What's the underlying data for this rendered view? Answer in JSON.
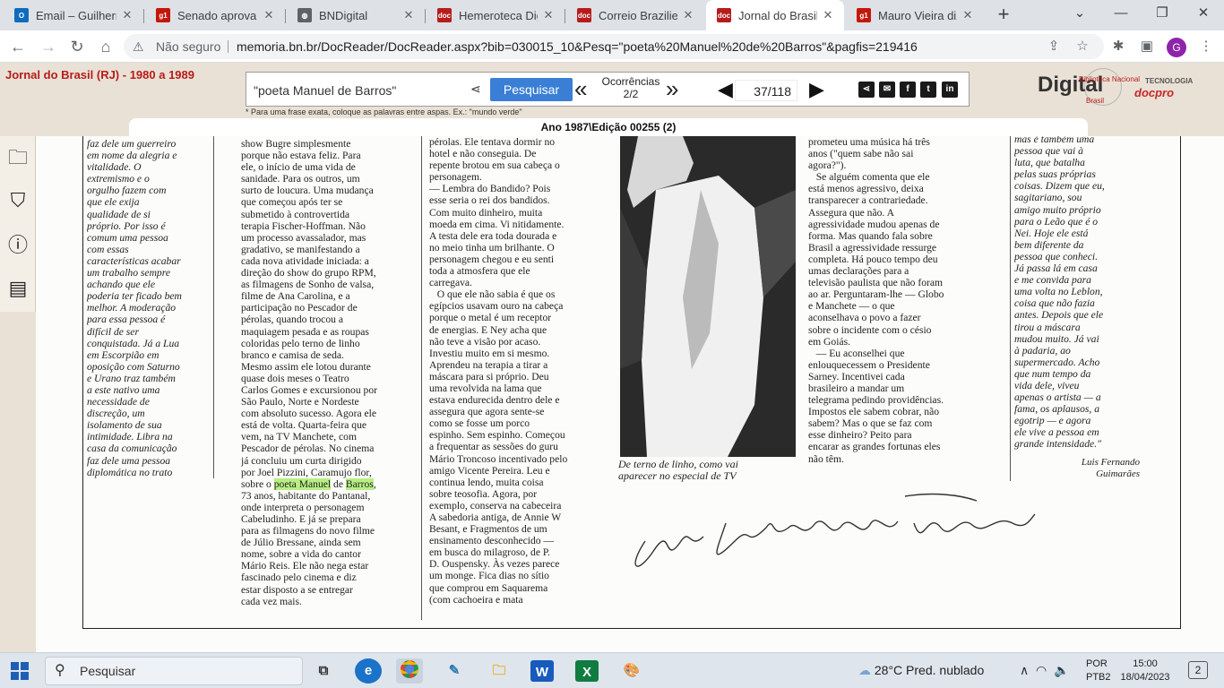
{
  "browser": {
    "tabs": [
      {
        "title": "Email – Guilherme",
        "favicon": "outlook-icon",
        "color": "#0f6cbd",
        "glyph": "O"
      },
      {
        "title": "Senado aprova Pl",
        "favicon": "g1-icon",
        "color": "#c4170c",
        "glyph": "g1"
      },
      {
        "title": "BNDigital",
        "favicon": "globe-icon",
        "color": "#5f6368",
        "glyph": "◍"
      },
      {
        "title": "Hemeroteca Digit",
        "favicon": "hemeroteca-icon",
        "color": "#b71c1c",
        "glyph": "doc"
      },
      {
        "title": "Correio Braziliens",
        "favicon": "hemeroteca-icon",
        "color": "#b71c1c",
        "glyph": "doc"
      },
      {
        "title": "Jornal do Brasil (I",
        "favicon": "hemeroteca-icon",
        "color": "#b71c1c",
        "glyph": "doc",
        "active": true
      },
      {
        "title": "Mauro Vieira diz",
        "favicon": "g1-icon",
        "color": "#c4170c",
        "glyph": "g1"
      }
    ],
    "security": "Não seguro",
    "url": "memoria.bn.br/DocReader/DocReader.aspx?bib=030015_10&Pesq=\"poeta%20Manuel%20de%20Barros\"&pagfis=219416",
    "profile_initial": "G"
  },
  "reader": {
    "publication_title": "Jornal do Brasil (RJ) - 1980 a 1989",
    "search_value": "\"poeta Manuel de Barros\"",
    "search_button": "Pesquisar",
    "occurrences_label": "Ocorrências",
    "occurrences_value": "2/2",
    "page_current": "37",
    "page_total": "/118",
    "hint": "* Para uma frase exata, coloque as palavras entre aspas. Ex.: \"mundo verde\"",
    "edition": "Ano 1987\\Edição 00255 (2)",
    "logo_text": "Digital",
    "logo_top": "Biblioteca Nacional",
    "logo_sub": "Brasil",
    "tech_label": "TECNOLOGIA",
    "docpro": "docpro",
    "social": [
      "share",
      "email",
      "facebook",
      "twitter",
      "linkedin"
    ]
  },
  "newspaper": {
    "col1": "faz dele um guerreiro\nem nome da alegria e\nvitalidade. O\nextremismo e o\norgulho fazem com\nque ele exija\nqualidade de si\npróprio. Por isso é\ncomum uma pessoa\ncom essas\ncaracterísticas acabar\num trabalho sempre\nachando que ele\npoderia ter ficado bem\nmelhor. A moderação\npara essa pessoa é\ndifícil de ser\nconquistada. Já a Lua\nem Escorpião em\noposição com Saturno\ne Urano traz também\na este nativo uma\nnecessidade de\ndiscreção, um\nisolamento de sua\nintimidade. Libra na\ncasa da comunicação\nfaz dele uma pessoa\ndiplomática no trato\nmas com pontos de\nvista já estabelecidos.\"",
    "col2_a": "show Bugre simplesmente\nporque não estava feliz. Para\nele, o início de uma vida de\nsanidade. Para os outros, um\nsurto de loucura. Uma mudança\nque começou após ter se\nsubmetido à controvertida\nterapia Fischer-Hoffman. Não\num processo avassalador, mas\ngradativo, se manifestando a\ncada nova atividade iniciada: a\ndireção do show do grupo RPM,\nas filmagens de Sonho de valsa,\nfilme de Ana Carolina, e a\nparticipação no Pescador de\npérolas, quando trocou a\nmaquiagem pesada e as roupas\ncoloridas pelo terno de linho\nbranco e camisa de seda.\nMesmo assim ele lotou durante\nquase dois meses o Teatro\nCarlos Gomes e excursionou por\nSão Paulo, Norte e Nordeste\ncom absoluto sucesso. Agora ele\nestá de volta. Quarta-feira que\nvem, na TV Manchete, com\nPescador de pérolas. No cinema\njá concluiu um curta dirigido\npor Joel Pizzini, Caramujo flor,",
    "col2_pre": "sobre o ",
    "col2_hl1": "poeta Manuel",
    "col2_mid": " de ",
    "col2_hl2": "Barros",
    "col2_post": ",",
    "col2_b": "73 anos, habitante do Pantanal,\nonde interpreta o personagem\nCabeludinho. E já se prepara\npara as filmagens do novo filme\nde Júlio Bressane, ainda sem\nnome, sobre a vida do cantor\nMário Reis. Ele não nega estar\nfascinado pelo cinema e diz\nestar disposto a se entregar\ncada vez mais.",
    "col3": "pérolas. Ele tentava dormir no\nhotel e não conseguia. De\nrepente brotou em sua cabeça o\npersonagem.\n— Lembra do Bandido? Pois\nesse seria o rei dos bandidos.\nCom muito dinheiro, muita\nmoeda em cima. Vi nitidamente.\nA testa dele era toda dourada e\nno meio tinha um brilhante. O\npersonagem chegou e eu senti\ntoda a atmosfera que ele\ncarregava.\n   O que ele não sabia é que os\negípcios usavam ouro na cabeça\nporque o metal é um receptor\nde energias. E Ney acha que\nnão teve a visão por acaso.\nInvestiu muito em si mesmo.\nAprendeu na terapia a tirar a\nmáscara para si próprio. Deu\numa revolvida na lama que\nestava endurecida dentro dele e\nassegura que agora sente-se\ncomo se fosse um porco\nespinho. Sem espinho. Começou\na frequentar as sessões do guru\nMário Troncoso incentivado pelo\namigo Vicente Pereira. Leu e\ncontinua lendo, muita coisa\nsobre teosofia. Agora, por\nexemplo, conserva na cabeceira\nA sabedoria antiga, de Annie W\nBesant, e Fragmentos de um\nensinamento desconhecido —\nem busca do milagroso, de P.\nD. Ouspensky. Às vezes parece\num monge. Fica dias no sítio\nque comprou em Saquarema\n(com cachoeira e mata",
    "caption": "De terno de linho, como vai\naparecer no especial de TV",
    "col5": "prometeu uma música há três\nanos (\"quem sabe não sai\nagora?\").\n   Se alguém comenta que ele\nestá menos agressivo, deixa\ntransparecer a contrariedade.\nAssegura que não. A\nagressividade mudou apenas de\nforma. Mas quando fala sobre\nBrasil a agressividade ressurge\ncompleta. Há pouco tempo deu\numas declarações para a\ntelevisão paulista que não foram\nao ar. Perguntaram-lhe — Globo\ne Manchete — o que\naconselhava o povo a fazer\nsobre o incidente com o césio\nem Goiás.\n   — Eu aconselhei que\nenlouquecessem o Presidente\nSarney. Incentivei cada\nbrasileiro a mandar um\ntelegrama pedindo providências.\nImpostos ele sabem cobrar, não\nsabem? Mas o que se faz com\nesse dinheiro? Peito para\nencarar as grandes fortunas eles\nnão têm.",
    "col6": "mas é também uma\npessoa que vai à\nluta, que batalha\npelas suas próprias\ncoisas. Dizem que eu,\nsagitariano, sou\namigo muito próprio\npara o Leão que é o\nNei. Hoje ele está\nbem diferente da\npessoa que conheci.\nJá passa lá em casa\ne me convida para\numa volta no Leblon,\ncoisa que não fazia\nantes. Depois que ele\ntirou a máscara\nmudou muito. Já vai\nà padaria, ao\nsupermercado. Acho\nque num tempo da\nvida dele, viveu\napenas o artista — a\nfama, os aplausos, a\negotrip — e agora\nele vive a pessoa em\ngrande intensidade.\"",
    "author": "Luis Fernando\nGuimarães"
  },
  "taskbar": {
    "search_placeholder": "Pesquisar",
    "weather": "28°C  Pred. nublado",
    "lang1": "POR",
    "lang2": "PTB2",
    "time": "15:00",
    "date": "18/04/2023",
    "notifications": "2"
  }
}
